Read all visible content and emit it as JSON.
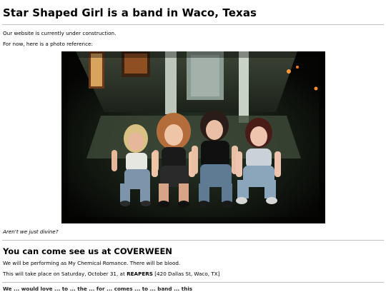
{
  "header": {
    "title": "Star Shaped Girl is a band in Waco, Texas"
  },
  "intro": {
    "line1": "Our website is currently under construction.",
    "line2": "For now, here is a photo reference:"
  },
  "photo": {
    "caption": "Aren't we just divine?"
  },
  "event": {
    "heading": "You can come see us at COVERWEEN",
    "line1": "We will be performing as My Chemical Romance. There will be blood.",
    "line2_prefix": "This will take place on Saturday, October 31, at ",
    "venue": "REAPERS",
    "line2_suffix": " [420 Dallas St, Waco, TX]"
  },
  "footer": {
    "partial_text": "We ... would love ... to ... the ... for ... comes ... to ... band ... this"
  },
  "colors": {
    "background": "#ffffff",
    "rule": "#bfbfbf",
    "text": "#000000"
  }
}
